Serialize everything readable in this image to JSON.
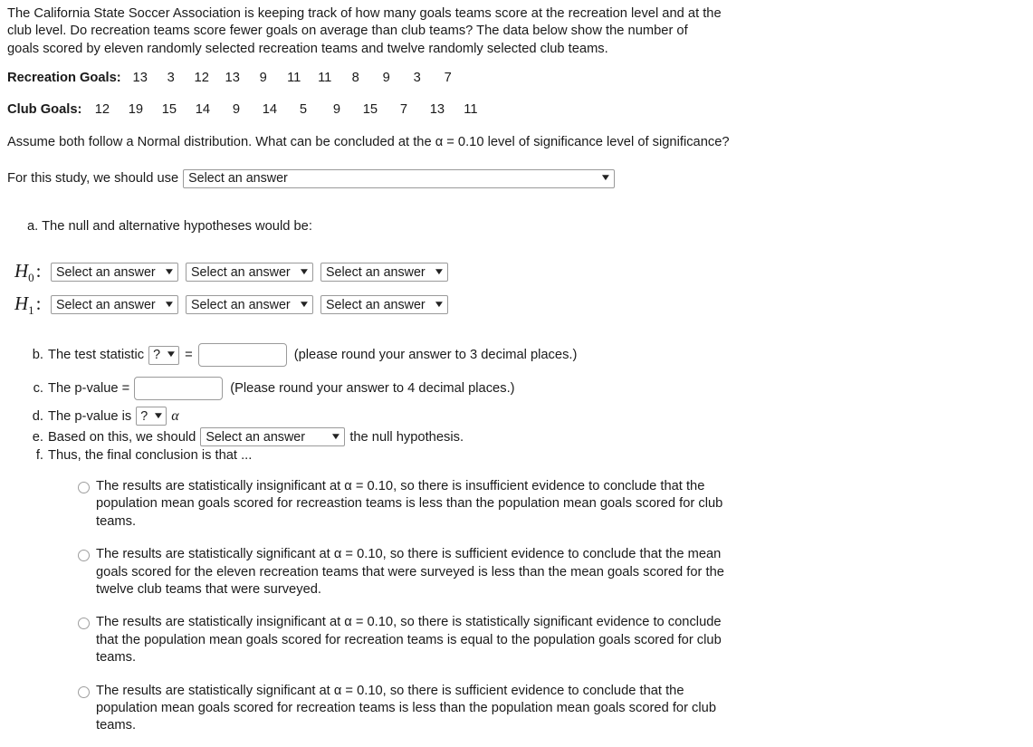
{
  "intro": "The California State Soccer Association is keeping track of how many goals teams score at the recreation level and at the club level. Do recreation teams score fewer goals on average than club teams? The data below show the number of goals scored by eleven randomly selected recreation teams and twelve randomly selected club teams.",
  "data": {
    "recreation_label": "Recreation Goals:",
    "recreation_values": [
      13,
      3,
      12,
      13,
      9,
      11,
      11,
      8,
      9,
      3,
      7
    ],
    "club_label": "Club Goals:",
    "club_values": [
      12,
      19,
      15,
      14,
      9,
      14,
      5,
      9,
      15,
      7,
      13,
      11
    ]
  },
  "assume": "Assume both follow a Normal distribution.  What can be concluded at the α = 0.10 level of significance level of significance?",
  "study": {
    "label": "For this study, we should use",
    "select_value": "Select an answer"
  },
  "part_a": {
    "prompt": "a. The null and alternative hypotheses would be:",
    "h0_name": "H",
    "h0_sub": "0",
    "h1_name": "H",
    "h1_sub": "1",
    "colon": ":",
    "select_value": "Select an answer"
  },
  "part_b": {
    "mark": "b.",
    "text": "The test statistic",
    "select_value": "?",
    "equals": "=",
    "note": "(please round your answer to 3 decimal places.)"
  },
  "part_c": {
    "mark": "c.",
    "text": "The p-value =",
    "note": "(Please round your answer to 4 decimal places.)"
  },
  "part_d": {
    "mark": "d.",
    "text": "The p-value is",
    "select_value": "?",
    "alpha": "α"
  },
  "part_e": {
    "mark": "e.",
    "text_before": "Based on this, we should",
    "select_value": "Select an answer",
    "text_after": "the null hypothesis."
  },
  "part_f": {
    "mark": "f.",
    "text": "Thus, the final conclusion is that ..."
  },
  "options": [
    "The results are statistically insignificant at α = 0.10, so there is insufficient evidence to conclude that the population mean goals scored for recreastion teams is less than the population mean goals scored for club teams.",
    "The results are statistically significant at α = 0.10, so there is sufficient evidence to conclude that the mean goals scored for the eleven recreation teams that were surveyed is less than the mean goals scored for the twelve club teams that were surveyed.",
    "The results are statistically insignificant at α = 0.10, so there is statistically significant evidence to conclude that the population mean goals scored for recreation teams is equal to the population goals scored for club teams.",
    "The results are statistically significant at α = 0.10, so there is sufficient evidence to conclude that the population mean goals scored for recreation teams is less than the population mean goals scored for club teams."
  ],
  "icons": {
    "chevron": "❯"
  }
}
